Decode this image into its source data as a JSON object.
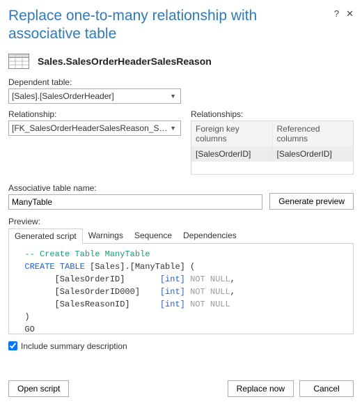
{
  "dialog": {
    "title": "Replace one-to-many relationship with associative table",
    "help": "?",
    "close": "✕"
  },
  "object": {
    "name": "Sales.SalesOrderHeaderSalesReason"
  },
  "labels": {
    "dependent_table": "Dependent table:",
    "relationship": "Relationship:",
    "relationships": "Relationships:",
    "assoc_name": "Associative table name:",
    "preview": "Preview:",
    "include_summary": "Include summary description"
  },
  "dependent_table": {
    "value": "[Sales].[SalesOrderHeader]"
  },
  "relationship": {
    "value": "[FK_SalesOrderHeaderSalesReason_SalesOrderHeader]"
  },
  "rel_table": {
    "headers": [
      "Foreign key columns",
      "Referenced columns"
    ],
    "row": [
      "[SalesOrderID]",
      "[SalesOrderID]"
    ]
  },
  "assoc_name": {
    "value": "ManyTable"
  },
  "buttons": {
    "generate_preview": "Generate preview",
    "open_script": "Open script",
    "replace_now": "Replace now",
    "cancel": "Cancel"
  },
  "tabs": [
    "Generated script",
    "Warnings",
    "Sequence",
    "Dependencies"
  ],
  "active_tab": 0,
  "script": {
    "comment": "-- Create Table ManyTable",
    "create": "CREATE TABLE",
    "name": " [Sales].[ManyTable] (",
    "cols": [
      {
        "name": "[SalesOrderID]",
        "type": "[int]",
        "null": "NOT NULL",
        "trail": ","
      },
      {
        "name": "[SalesOrderID000]",
        "type": "[int]",
        "null": "NOT NULL",
        "trail": ","
      },
      {
        "name": "[SalesReasonID]",
        "type": "[int]",
        "null": "NOT NULL",
        "trail": ""
      }
    ],
    "close": ")",
    "go": "GO"
  },
  "include_summary_checked": true
}
